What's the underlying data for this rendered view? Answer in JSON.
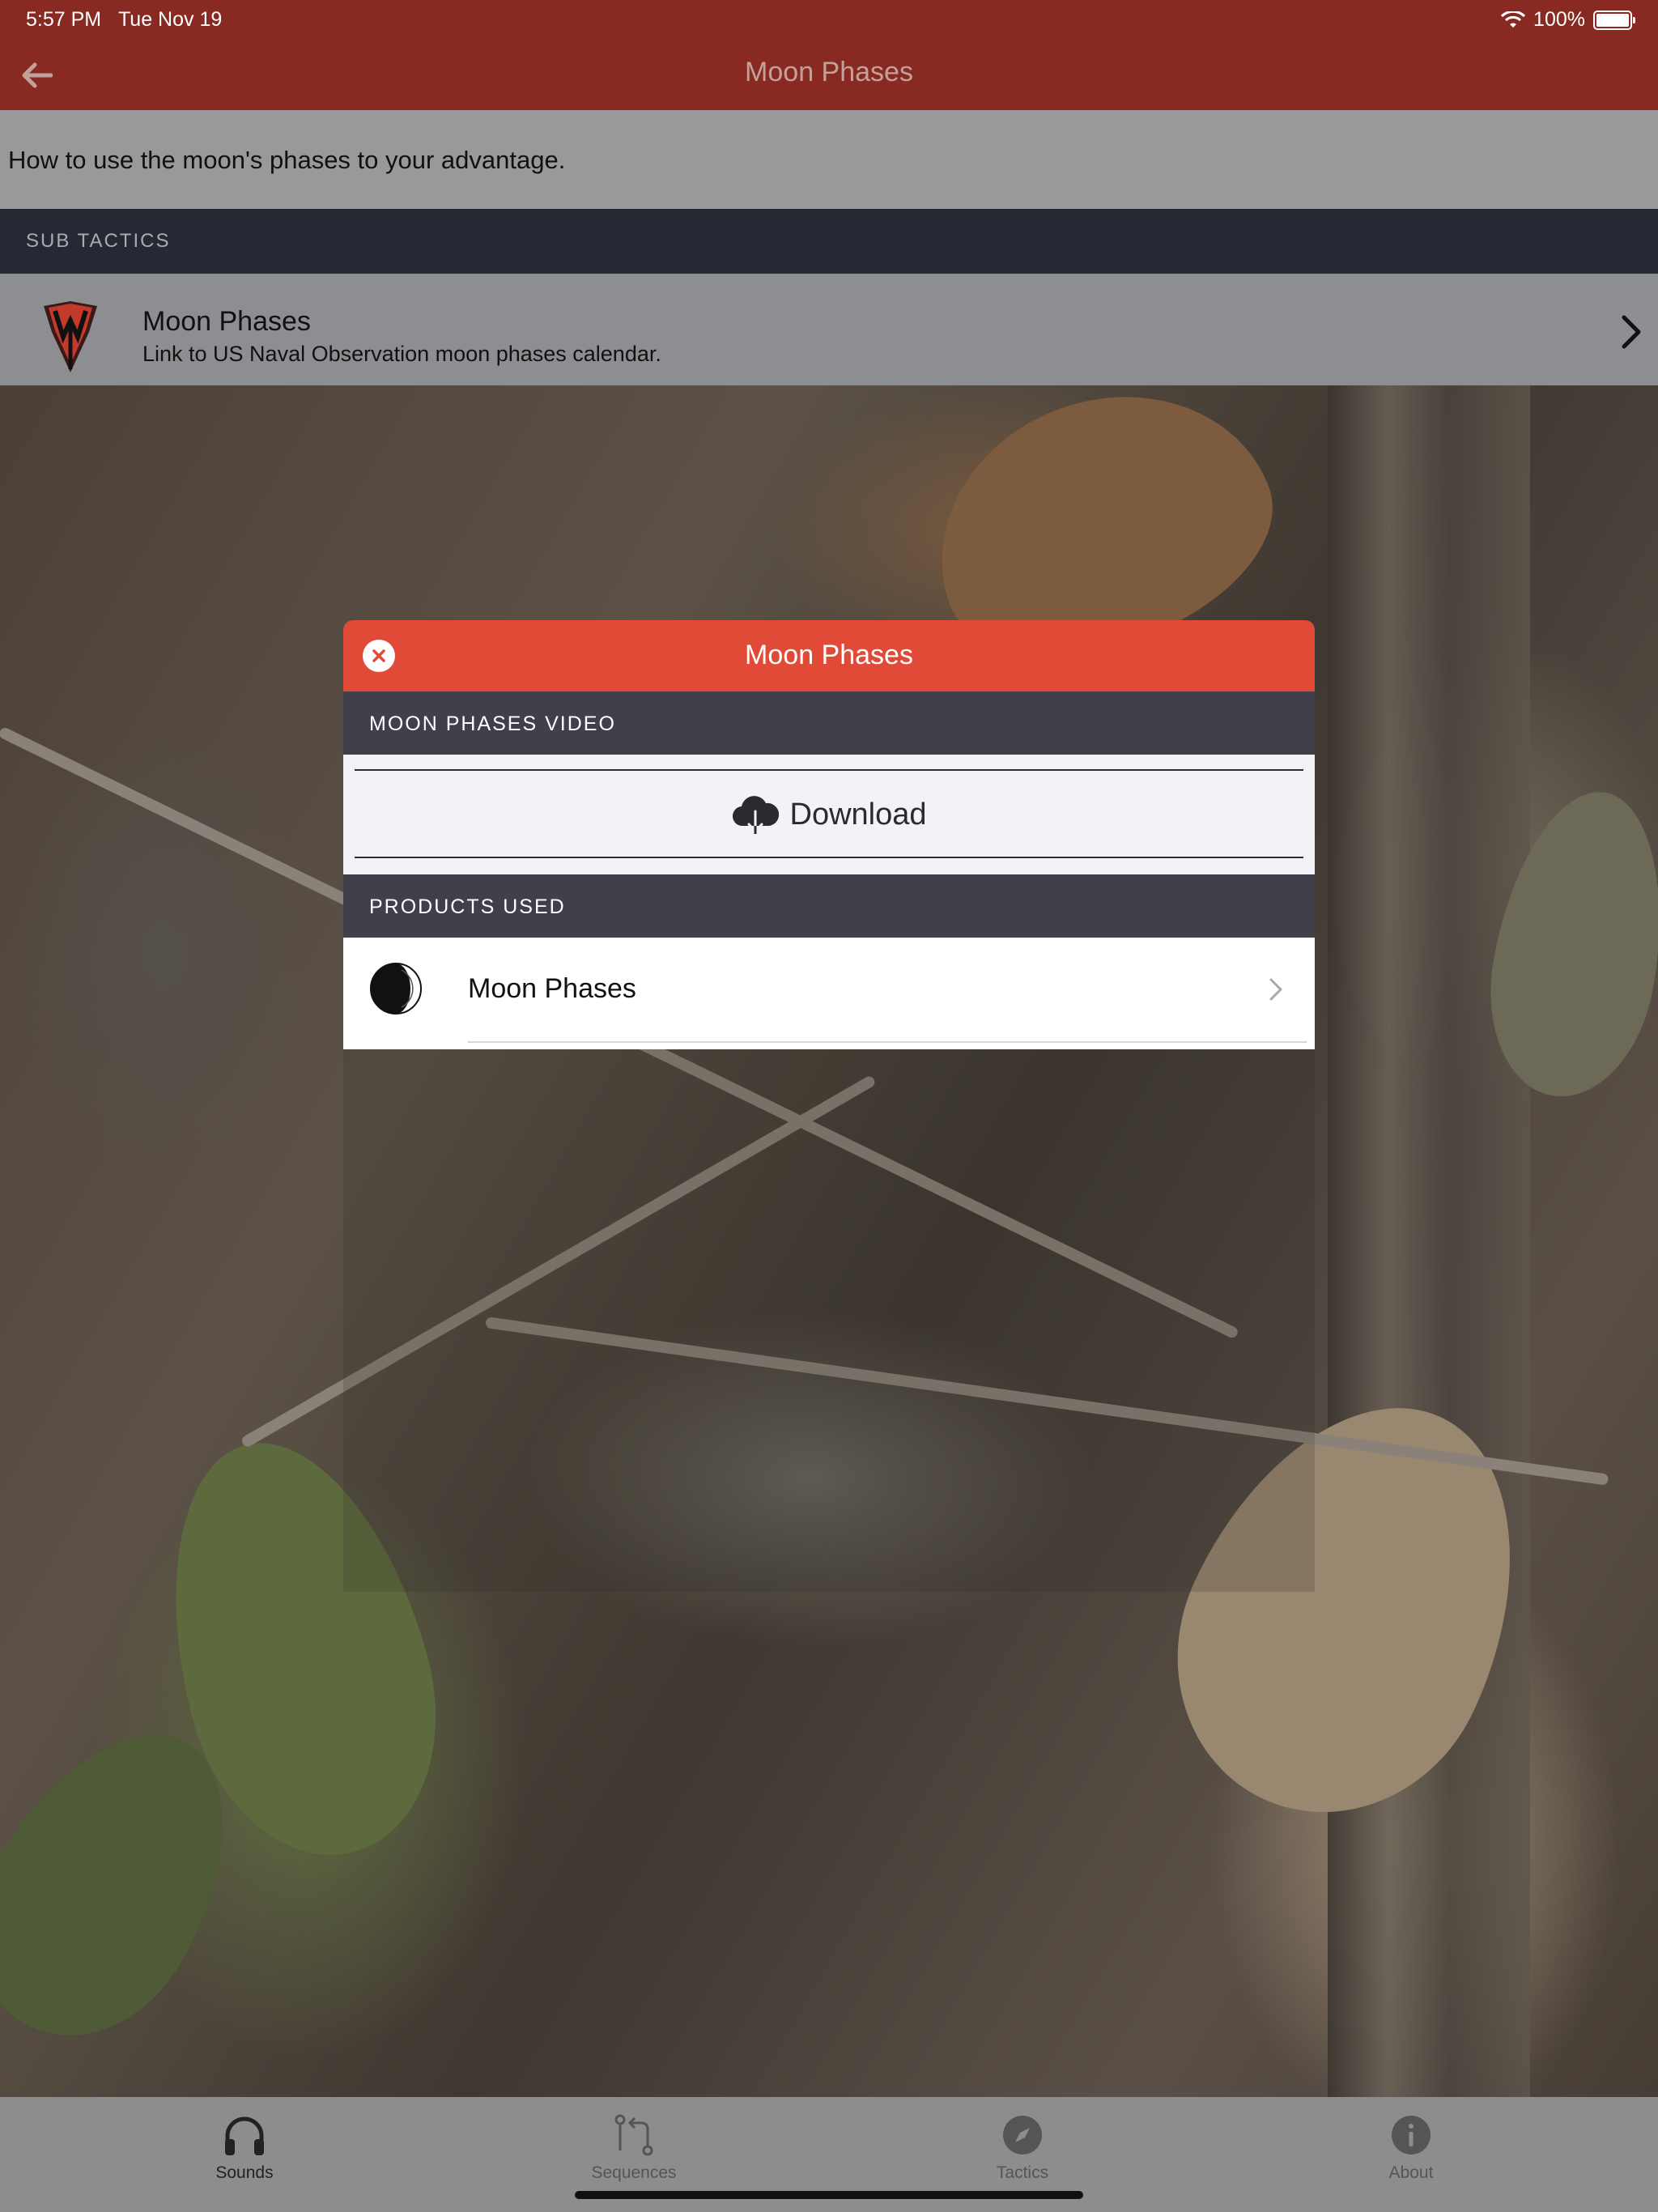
{
  "status": {
    "time": "5:57 PM",
    "date": "Tue Nov 19",
    "battery": "100%"
  },
  "nav": {
    "title": "Moon Phases"
  },
  "description": "How to use the moon's phases to your advantage.",
  "sub_tactics": {
    "header": "SUB TACTICS",
    "items": [
      {
        "title": "Moon Phases",
        "subtitle": "Link to US Naval Observation moon phases calendar."
      }
    ]
  },
  "modal": {
    "title": "Moon Phases",
    "video_section": "MOON PHASES VIDEO",
    "download_label": "Download",
    "products_section": "PRODUCTS USED",
    "products": [
      {
        "label": "Moon Phases"
      }
    ]
  },
  "tabs": [
    {
      "label": "Sounds",
      "icon": "headphones-icon",
      "active": true
    },
    {
      "label": "Sequences",
      "icon": "sequence-icon",
      "active": false
    },
    {
      "label": "Tactics",
      "icon": "compass-icon",
      "active": false
    },
    {
      "label": "About",
      "icon": "info-icon",
      "active": false
    }
  ],
  "colors": {
    "nav_bar": "#882922",
    "modal_header": "#e04a37",
    "section_header": "#3f404a",
    "sub_header": "#262834",
    "tab_active": "#222222",
    "tab_inactive": "#555555"
  }
}
